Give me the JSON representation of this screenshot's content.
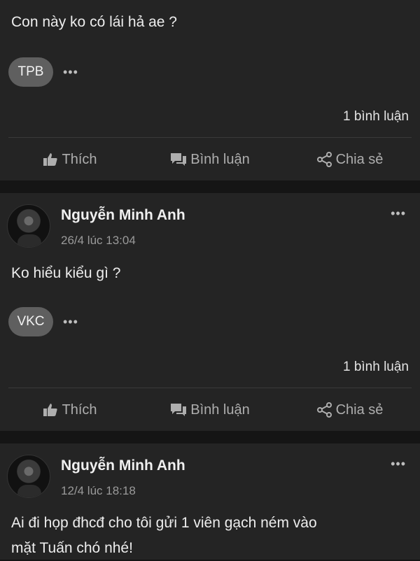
{
  "posts": [
    {
      "text": "Con này ko có lái hả ae ?",
      "chip": "TPB",
      "more": "•••",
      "comments": "1 bình luận",
      "actions": {
        "like": "Thích",
        "comment": "Bình luận",
        "share": "Chia sẻ"
      }
    },
    {
      "author": "Nguyễn Minh Anh",
      "timestamp": "26/4 lúc 13:04",
      "header_more": "•••",
      "text": "Ko hiểu kiểu gì ?",
      "chip": "VKC",
      "more": "•••",
      "comments": "1 bình luận",
      "actions": {
        "like": "Thích",
        "comment": "Bình luận",
        "share": "Chia sẻ"
      }
    },
    {
      "author": "Nguyễn Minh Anh",
      "timestamp": "12/4 lúc 18:18",
      "header_more": "•••",
      "text_lines": [
        "Ai đi họp đhcđ cho tôi gửi 1 viên gạch ném vào",
        "mặt Tuấn chó nhé!"
      ]
    }
  ],
  "icons": {
    "like": "thumbs-up-icon",
    "comment": "comment-icon",
    "share": "share-icon"
  },
  "colors": {
    "background": "#151515",
    "card": "#242424",
    "chip": "#5f5f5f"
  }
}
